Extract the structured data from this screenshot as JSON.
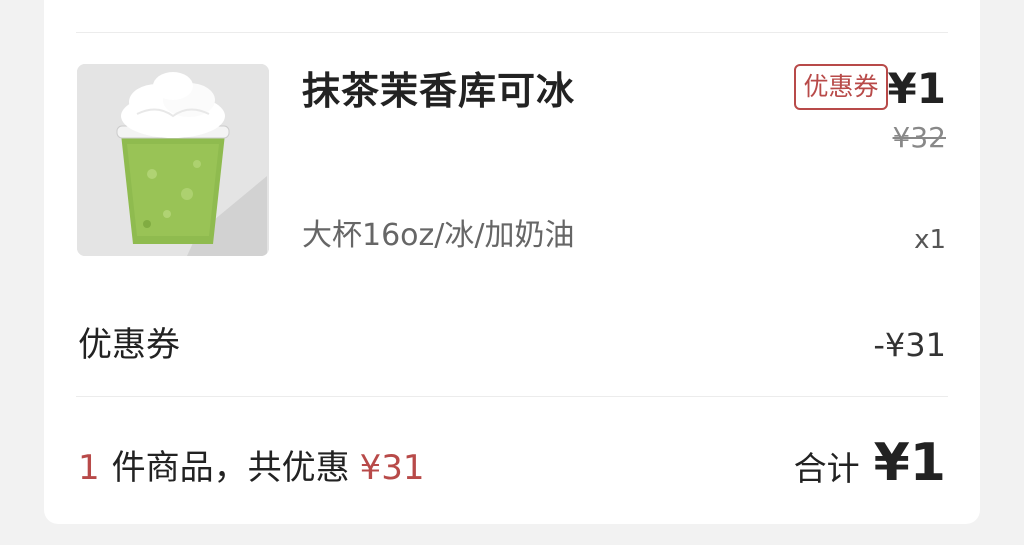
{
  "order_item": {
    "image_icon": "matcha-frappuccino-cup",
    "name": "抹茶茉香库可冰",
    "spec": "大杯16oz/冰/加奶油",
    "coupon_tag": "优惠券",
    "price": "¥1",
    "original_price": "¥32",
    "quantity": "x1"
  },
  "coupon_row": {
    "label": "优惠券",
    "value": "-¥31"
  },
  "summary": {
    "count": "1",
    "count_text": "件商品，共优惠",
    "saving": "¥31",
    "total_label": "合计",
    "total_value": "¥1"
  },
  "colors": {
    "accent_red": "#b84a49",
    "matcha_green": "#8ab84a"
  }
}
